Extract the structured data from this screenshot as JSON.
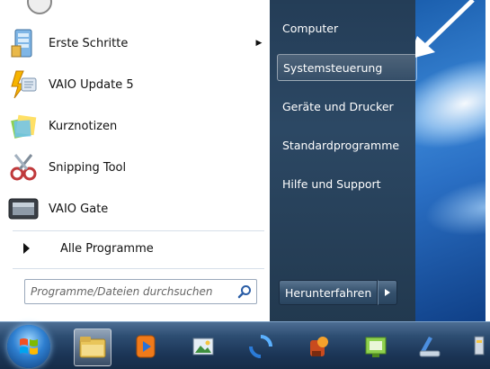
{
  "start_menu": {
    "left_items": [
      {
        "label": "Erste Schritte",
        "icon": "getting-started-icon",
        "submenu": true
      },
      {
        "label": "VAIO Update 5",
        "icon": "vaio-update-icon",
        "submenu": false
      },
      {
        "label": "Kurznotizen",
        "icon": "sticky-notes-icon",
        "submenu": false
      },
      {
        "label": "Snipping Tool",
        "icon": "scissors-icon",
        "submenu": false
      },
      {
        "label": "VAIO Gate",
        "icon": "vaio-gate-icon",
        "submenu": false
      }
    ],
    "all_programs_label": "Alle Programme",
    "search_placeholder": "Programme/Dateien durchsuchen",
    "right_items": [
      {
        "label": "Computer"
      },
      {
        "label": "Systemsteuerung",
        "highlighted": true
      },
      {
        "label": "Geräte und Drucker"
      },
      {
        "label": "Standardprogramme"
      },
      {
        "label": "Hilfe und Support"
      }
    ],
    "shutdown_label": "Herunterfahren"
  },
  "taskbar": {
    "icons": [
      "start-orb-icon",
      "explorer-folder-icon",
      "media-player-icon",
      "image-viewer-icon",
      "sync-icon",
      "media-center-icon",
      "presentation-icon",
      "scanner-icon",
      "network-icon"
    ]
  },
  "colors": {
    "right_pane": "#2c4864",
    "taskbar": "#1b3556",
    "accent": "#2e7fd0"
  }
}
